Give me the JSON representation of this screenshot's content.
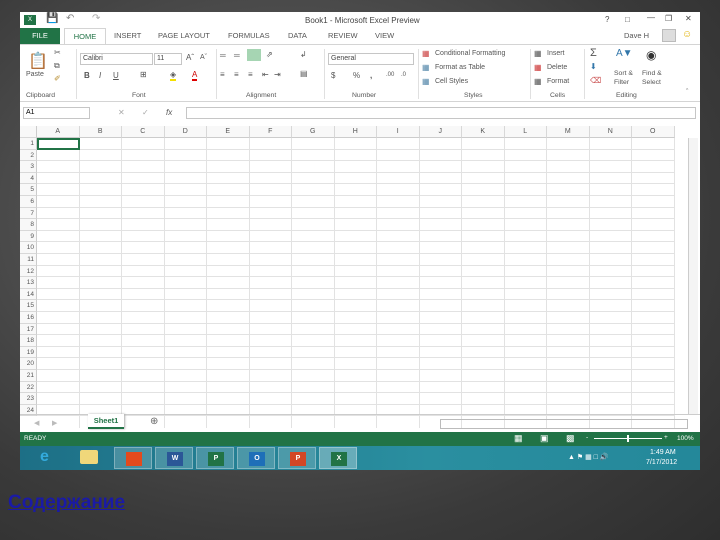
{
  "title": "Book1 - Microsoft Excel Preview",
  "window_controls": [
    "?",
    "restore-ribbon",
    "minimize",
    "maximize",
    "close"
  ],
  "user": "Dave H",
  "tabs": [
    "FILE",
    "HOME",
    "INSERT",
    "PAGE LAYOUT",
    "FORMULAS",
    "DATA",
    "REVIEW",
    "VIEW"
  ],
  "ribbon": {
    "clipboard": {
      "paste": "Paste",
      "label": "Clipboard"
    },
    "font": {
      "name": "Calibri",
      "size": "11",
      "label": "Font",
      "bold": "B",
      "italic": "I",
      "underline": "U"
    },
    "alignment": {
      "label": "Alignment"
    },
    "number": {
      "format": "General",
      "label": "Number",
      "currency": "$",
      "percent": "%",
      "comma": ","
    },
    "styles": {
      "conditional": "Conditional Formatting",
      "format_table": "Format as Table",
      "cell_styles": "Cell Styles",
      "label": "Styles"
    },
    "cells": {
      "insert": "Insert",
      "delete": "Delete",
      "format": "Format",
      "label": "Cells"
    },
    "editing": {
      "sort": "Sort &",
      "sort2": "Filter",
      "find": "Find &",
      "find2": "Select",
      "label": "Editing"
    }
  },
  "formula_bar": {
    "name_box": "A1",
    "fx": "fx",
    "value": ""
  },
  "columns": [
    "A",
    "B",
    "C",
    "D",
    "E",
    "F",
    "G",
    "H",
    "I",
    "J",
    "K",
    "L",
    "M",
    "N",
    "O"
  ],
  "rows": [
    "1",
    "2",
    "3",
    "4",
    "5",
    "6",
    "7",
    "8",
    "9",
    "10",
    "11",
    "12",
    "13",
    "14",
    "15",
    "16",
    "17",
    "18",
    "19",
    "20",
    "21",
    "22",
    "23",
    "24"
  ],
  "sheet_tab": "Sheet1",
  "status": {
    "text": "READY",
    "zoom": "100%",
    "zoom_level": 100
  },
  "taskbar": {
    "apps": [
      "internet-explorer",
      "file-explorer",
      "office",
      "word",
      "project",
      "outlook",
      "powerpoint",
      "excel"
    ],
    "time": "1:49 AM",
    "date": "7/17/2012"
  },
  "link": "Содержание",
  "colors": {
    "accent": "#217346",
    "link": "#1a1aa6"
  }
}
